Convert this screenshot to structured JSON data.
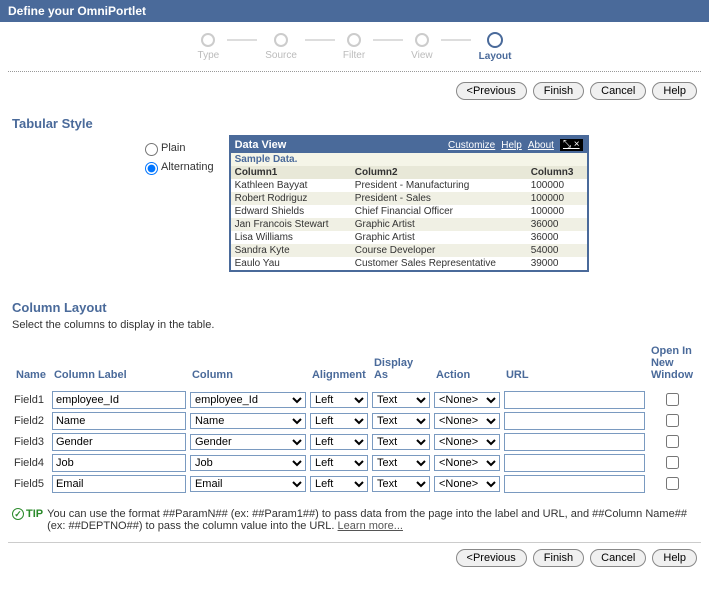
{
  "header": {
    "title": "Define your OmniPortlet"
  },
  "wizard": {
    "steps": [
      "Type",
      "Source",
      "Filter",
      "View",
      "Layout"
    ],
    "activeIndex": 4
  },
  "buttons": {
    "previous": "<Previous",
    "finish": "Finish",
    "cancel": "Cancel",
    "help": "Help"
  },
  "tabularStyle": {
    "title": "Tabular Style",
    "options": {
      "plain": "Plain",
      "alternating": "Alternating"
    },
    "selected": "alternating"
  },
  "dataView": {
    "title": "Data View",
    "links": {
      "customize": "Customize",
      "help": "Help",
      "about": "About"
    },
    "sampleLabel": "Sample Data.",
    "columns": [
      "Column1",
      "Column2",
      "Column3"
    ],
    "rows": [
      {
        "c1": "Kathleen Bayyat",
        "c2": "President - Manufacturing",
        "c3": "100000"
      },
      {
        "c1": "Robert Rodriguz",
        "c2": "President - Sales",
        "c3": "100000"
      },
      {
        "c1": "Edward Shields",
        "c2": "Chief Financial Officer",
        "c3": "100000"
      },
      {
        "c1": "Jan Francois Stewart",
        "c2": "Graphic Artist",
        "c3": "36000"
      },
      {
        "c1": "Lisa Williams",
        "c2": "Graphic Artist",
        "c3": "36000"
      },
      {
        "c1": "Sandra Kyte",
        "c2": "Course Developer",
        "c3": "54000"
      },
      {
        "c1": "Eaulo Yau",
        "c2": "Customer Sales Representative",
        "c3": "39000"
      }
    ]
  },
  "columnLayout": {
    "title": "Column Layout",
    "desc": "Select the columns to display in the table.",
    "headers": {
      "name": "Name",
      "columnLabel": "Column Label",
      "column": "Column",
      "alignment": "Alignment",
      "displayAs": "Display As",
      "action": "Action",
      "url": "URL",
      "openInNewWindow": "Open In New Window"
    },
    "fields": [
      {
        "name": "Field1",
        "label": "employee_Id",
        "column": "employee_Id",
        "alignment": "Left",
        "displayAs": "Text",
        "action": "<None>",
        "url": "",
        "newWindow": false
      },
      {
        "name": "Field2",
        "label": "Name",
        "column": "Name",
        "alignment": "Left",
        "displayAs": "Text",
        "action": "<None>",
        "url": "",
        "newWindow": false
      },
      {
        "name": "Field3",
        "label": "Gender",
        "column": "Gender",
        "alignment": "Left",
        "displayAs": "Text",
        "action": "<None>",
        "url": "",
        "newWindow": false
      },
      {
        "name": "Field4",
        "label": "Job",
        "column": "Job",
        "alignment": "Left",
        "displayAs": "Text",
        "action": "<None>",
        "url": "",
        "newWindow": false
      },
      {
        "name": "Field5",
        "label": "Email",
        "column": "Email",
        "alignment": "Left",
        "displayAs": "Text",
        "action": "<None>",
        "url": "",
        "newWindow": false
      }
    ]
  },
  "tip": {
    "label": "TIP",
    "text": "You can use the format ##ParamN## (ex: ##Param1##) to pass data from the page into the label and URL, and ##Column Name## (ex: ##DEPTNO##) to pass the column value into the URL. ",
    "learnMore": "Learn more..."
  }
}
